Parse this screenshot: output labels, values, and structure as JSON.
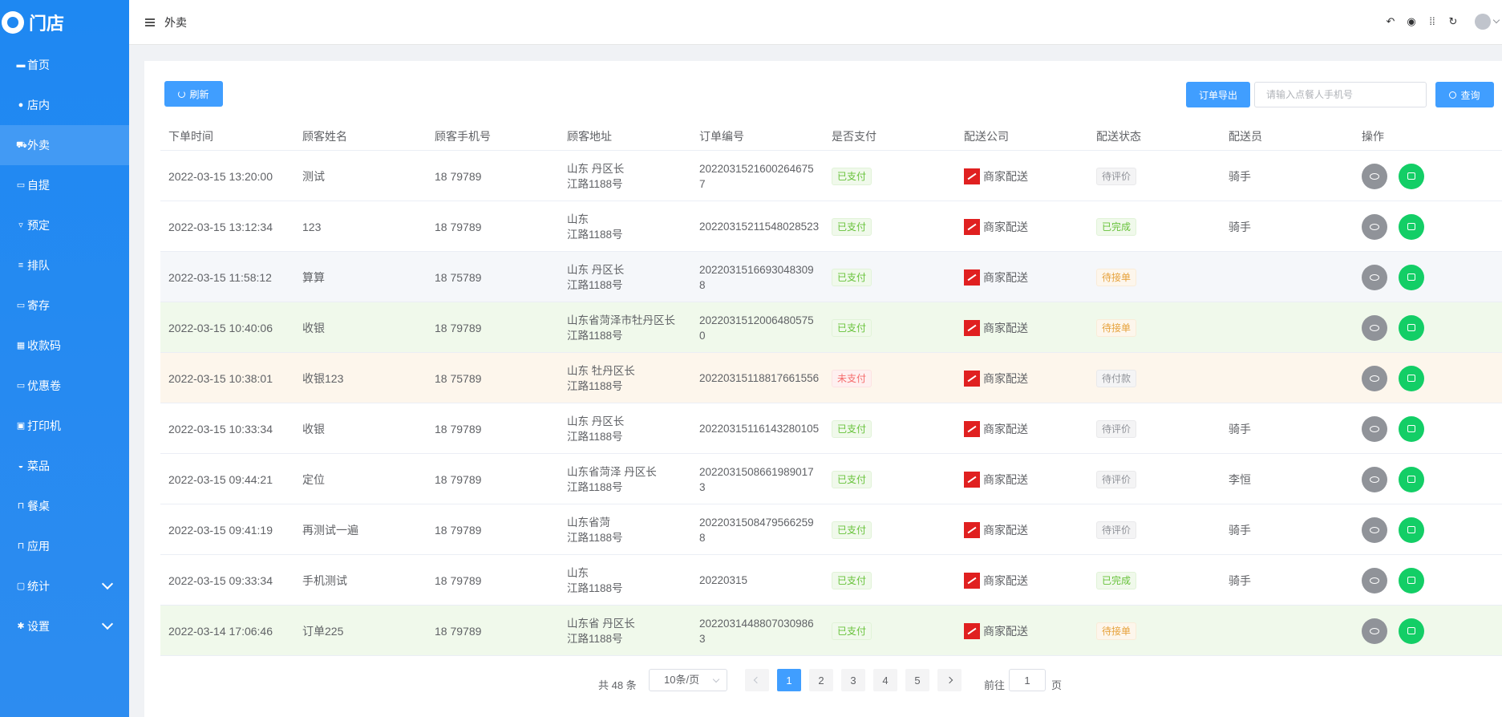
{
  "app": {
    "logo_text": "门店"
  },
  "sidebar": {
    "items": [
      {
        "label": "首页",
        "icon": "home-icon"
      },
      {
        "label": "店内",
        "icon": "user-icon"
      },
      {
        "label": "外卖",
        "icon": "delivery-icon",
        "active": true
      },
      {
        "label": "自提",
        "icon": "bag-icon"
      },
      {
        "label": "预定",
        "icon": "cart-icon"
      },
      {
        "label": "排队",
        "icon": "queue-icon"
      },
      {
        "label": "寄存",
        "icon": "storage-icon"
      },
      {
        "label": "收款码",
        "icon": "qrcode-icon"
      },
      {
        "label": "优惠卷",
        "icon": "coupon-icon"
      },
      {
        "label": "打印机",
        "icon": "printer-icon"
      },
      {
        "label": "菜品",
        "icon": "dish-icon"
      },
      {
        "label": "餐桌",
        "icon": "table-icon"
      },
      {
        "label": "应用",
        "icon": "app-icon"
      },
      {
        "label": "统计",
        "icon": "stats-icon",
        "expandable": true
      },
      {
        "label": "设置",
        "icon": "settings-icon",
        "expandable": true
      }
    ]
  },
  "header": {
    "title": "外卖",
    "icons": [
      "back-icon",
      "theme-icon",
      "grid-icon",
      "refresh-icon",
      "avatar"
    ]
  },
  "toolbar": {
    "refresh_label": "刷新",
    "export_label": "订单导出",
    "search_placeholder": "请输入点餐人手机号",
    "search_label": "查询"
  },
  "table": {
    "headers": [
      "下单时间",
      "顾客姓名",
      "顾客手机号",
      "顾客地址",
      "订单编号",
      "是否支付",
      "配送公司",
      "配送状态",
      "配送员",
      "操作"
    ],
    "rows": [
      {
        "time": "2022-03-15 13:20:00",
        "name": "测试",
        "phone": "18      79789",
        "addr1": "山东      丹区长",
        "addr2": "江路1188号",
        "order": "20220315216002646757",
        "paid": "已支付",
        "paid_type": "paid",
        "company": "商家配送",
        "status": "待评价",
        "status_type": "gray",
        "rider": "骑手",
        "row_style": ""
      },
      {
        "time": "2022-03-15 13:12:34",
        "name": "123",
        "phone": "18      79789",
        "addr1": "山东",
        "addr2": "江路1188号",
        "order": "20220315211548028523",
        "paid": "已支付",
        "paid_type": "paid",
        "company": "商家配送",
        "status": "已完成",
        "status_type": "done",
        "rider": "骑手",
        "row_style": ""
      },
      {
        "time": "2022-03-15 11:58:12",
        "name": "算算",
        "phone": "18      75789",
        "addr1": "山东      丹区长",
        "addr2": "江路1188号",
        "order": "20220315166930483098",
        "paid": "已支付",
        "paid_type": "paid",
        "company": "商家配送",
        "status": "待接单",
        "status_type": "wait",
        "rider": "",
        "row_style": "st-gray"
      },
      {
        "time": "2022-03-15 10:40:06",
        "name": "收银",
        "phone": "18      79789",
        "addr1": "山东省菏泽市牡丹区长",
        "addr2": "江路1188号",
        "order": "20220315120064805750",
        "paid": "已支付",
        "paid_type": "paid",
        "company": "商家配送",
        "status": "待接单",
        "status_type": "wait",
        "rider": "",
        "row_style": "st-green"
      },
      {
        "time": "2022-03-15 10:38:01",
        "name": "收银123",
        "phone": "18      75789",
        "addr1": "山东      牡丹区长",
        "addr2": "江路1188号",
        "order": "20220315118817661556",
        "paid": "未支付",
        "paid_type": "unpaid",
        "company": "商家配送",
        "status": "待付款",
        "status_type": "gray",
        "rider": "",
        "row_style": "st-orange"
      },
      {
        "time": "2022-03-15 10:33:34",
        "name": "收银",
        "phone": "18      79789",
        "addr1": "山东      丹区长",
        "addr2": "江路1188号",
        "order": "20220315116143280105",
        "paid": "已支付",
        "paid_type": "paid",
        "company": "商家配送",
        "status": "待评价",
        "status_type": "gray",
        "rider": "骑手",
        "row_style": ""
      },
      {
        "time": "2022-03-15 09:44:21",
        "name": "定位",
        "phone": "18      79789",
        "addr1": "山东省菏泽      丹区长",
        "addr2": "江路1188号",
        "order": "20220315086619890173",
        "paid": "已支付",
        "paid_type": "paid",
        "company": "商家配送",
        "status": "待评价",
        "status_type": "gray",
        "rider": "李恒",
        "row_style": ""
      },
      {
        "time": "2022-03-15 09:41:19",
        "name": "再测试一遍",
        "phone": "18      79789",
        "addr1": "山东省菏",
        "addr2": "江路1188号",
        "order": "20220315084795662598",
        "paid": "已支付",
        "paid_type": "paid",
        "company": "商家配送",
        "status": "待评价",
        "status_type": "gray",
        "rider": "骑手",
        "row_style": ""
      },
      {
        "time": "2022-03-15 09:33:34",
        "name": "手机测试",
        "phone": "18      79789",
        "addr1": "山东",
        "addr2": "江路1188号",
        "order": "20220315",
        "paid": "已支付",
        "paid_type": "paid",
        "company": "商家配送",
        "status": "已完成",
        "status_type": "done",
        "rider": "骑手",
        "row_style": ""
      },
      {
        "time": "2022-03-14 17:06:46",
        "name": "订单225",
        "phone": "18      79789",
        "addr1": "山东省      丹区长",
        "addr2": "江路1188号",
        "order": "20220314488070309863",
        "paid": "已支付",
        "paid_type": "paid",
        "company": "商家配送",
        "status": "待接单",
        "status_type": "wait",
        "rider": "",
        "row_style": "st-green"
      }
    ]
  },
  "pagination": {
    "total_text": "共 48 条",
    "page_size": "10条/页",
    "pages": [
      "1",
      "2",
      "3",
      "4",
      "5"
    ],
    "current_page": "1",
    "goto_label": "前往",
    "goto_value": "1",
    "page_suffix": "页"
  },
  "colors": {
    "sidebar_bg": "#1e88f2",
    "primary": "#409eff",
    "success": "#13ce66",
    "company_logo": "#e02020"
  }
}
